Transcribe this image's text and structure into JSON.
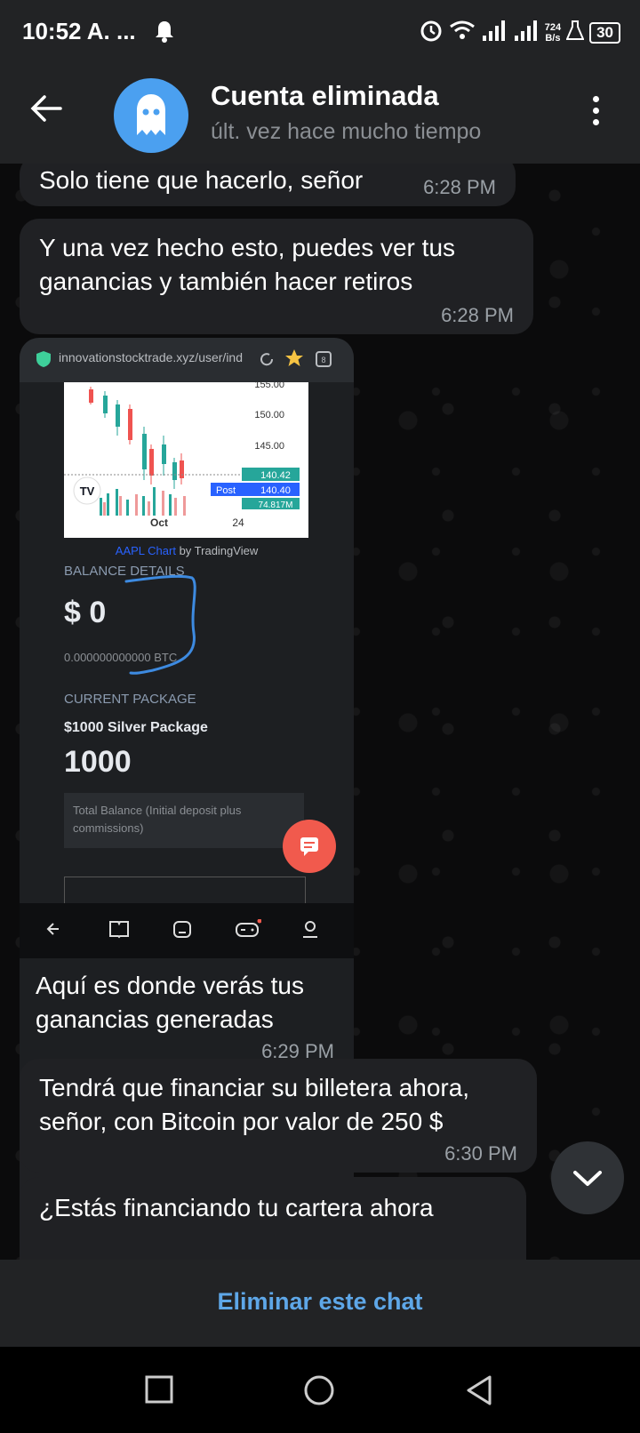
{
  "status_bar": {
    "time": "10:52 A. ...",
    "net_speed_value": "724",
    "net_speed_unit": "B/s",
    "battery": "30"
  },
  "header": {
    "title": "Cuenta eliminada",
    "subtitle": "últ. vez hace mucho tiempo"
  },
  "messages": [
    {
      "text": "Solo tiene que hacerlo, señor",
      "time": "6:28 PM"
    },
    {
      "text": "Y una vez hecho esto, puedes ver tus ganancias y también hacer retiros",
      "time": "6:28 PM"
    },
    {
      "text": "Aquí es donde verás tus ganancias generadas",
      "time": "6:29 PM"
    },
    {
      "text": "Tendrá que financiar su billetera ahora, señor, con Bitcoin por valor de 250 $",
      "time": "6:30 PM"
    },
    {
      "text": "¿Estás financiando tu cartera ahora"
    }
  ],
  "screenshot": {
    "url": "innovationstocktrade.xyz/user/ind",
    "chart_prices": [
      "155.00",
      "150.00",
      "145.00"
    ],
    "price_label_1": "140.42",
    "price_label_2": "140.40",
    "post_label": "Post",
    "volume_label": "74.817M",
    "x_label_1": "Oct",
    "x_label_2": "24",
    "chart_caption_link": "AAPL Chart",
    "chart_caption_rest": " by TradingView",
    "balance_label": "BALANCE DETAILS",
    "balance_value": "$ 0",
    "btc_value": "0.000000000000 BTC",
    "package_label": "CURRENT PACKAGE",
    "package_name": "$1000 Silver Package",
    "package_value": "1000",
    "total_balance_text": "Total Balance (Initial deposit plus commissions)",
    "tradingview_logo": "TV"
  },
  "footer": {
    "delete_label": "Eliminar este chat"
  }
}
